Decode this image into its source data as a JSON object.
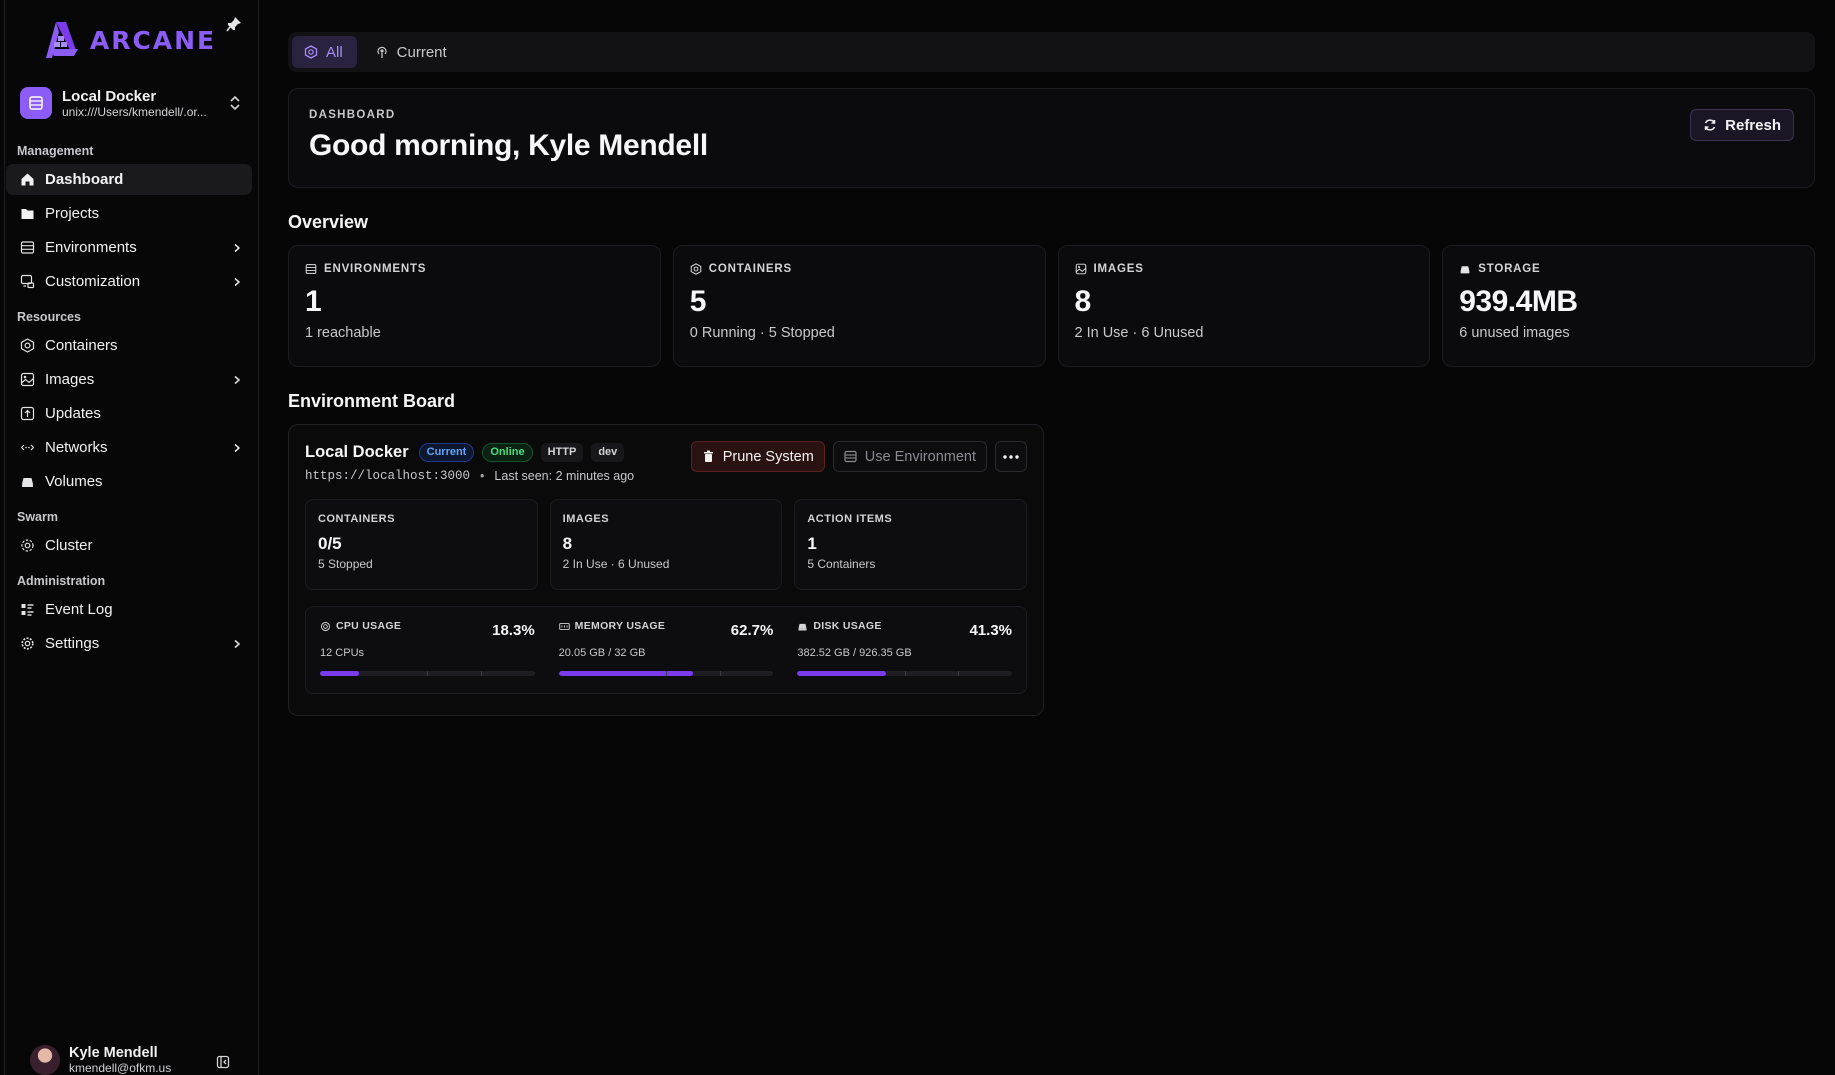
{
  "brand": {
    "name": "ARCANE",
    "accent": "#8b5cf6"
  },
  "env_switcher": {
    "name": "Local Docker",
    "socket": "unix:///Users/kmendell/.or..."
  },
  "sidebar": {
    "sections": [
      {
        "label": "Management",
        "items": [
          {
            "label": "Dashboard",
            "icon": "home-icon",
            "active": true,
            "chevron": false
          },
          {
            "label": "Projects",
            "icon": "folder-icon",
            "active": false,
            "chevron": false
          },
          {
            "label": "Environments",
            "icon": "server-icon",
            "active": false,
            "chevron": true
          },
          {
            "label": "Customization",
            "icon": "customize-icon",
            "active": false,
            "chevron": true
          }
        ]
      },
      {
        "label": "Resources",
        "items": [
          {
            "label": "Containers",
            "icon": "container-icon",
            "active": false,
            "chevron": false
          },
          {
            "label": "Images",
            "icon": "image-icon",
            "active": false,
            "chevron": true
          },
          {
            "label": "Updates",
            "icon": "update-icon",
            "active": false,
            "chevron": false
          },
          {
            "label": "Networks",
            "icon": "network-icon",
            "active": false,
            "chevron": true
          },
          {
            "label": "Volumes",
            "icon": "volume-icon",
            "active": false,
            "chevron": false
          }
        ]
      },
      {
        "label": "Swarm",
        "items": [
          {
            "label": "Cluster",
            "icon": "cluster-icon",
            "active": false,
            "chevron": false
          }
        ]
      },
      {
        "label": "Administration",
        "items": [
          {
            "label": "Event Log",
            "icon": "event-log-icon",
            "active": false,
            "chevron": false
          },
          {
            "label": "Settings",
            "icon": "gear-icon",
            "active": false,
            "chevron": true
          }
        ]
      }
    ]
  },
  "user": {
    "name": "Kyle Mendell",
    "email": "kmendell@ofkm.us"
  },
  "tabs": [
    {
      "label": "All",
      "active": true
    },
    {
      "label": "Current",
      "active": false
    }
  ],
  "hero": {
    "eyebrow": "DASHBOARD",
    "title": "Good morning, Kyle Mendell",
    "refresh_label": "Refresh"
  },
  "overview": {
    "title": "Overview",
    "cards": [
      {
        "label": "ENVIRONMENTS",
        "value": "1",
        "sub": "1 reachable",
        "icon": "server-icon"
      },
      {
        "label": "CONTAINERS",
        "value": "5",
        "sub": "0 Running · 5 Stopped",
        "icon": "container-icon"
      },
      {
        "label": "IMAGES",
        "value": "8",
        "sub": "2 In Use · 6 Unused",
        "icon": "image-icon"
      },
      {
        "label": "STORAGE",
        "value": "939.4MB",
        "sub": "6 unused images",
        "icon": "storage-icon"
      }
    ]
  },
  "board": {
    "title": "Environment Board",
    "env": {
      "name": "Local Docker",
      "badges": {
        "current": "Current",
        "online": "Online",
        "protocol": "HTTP",
        "tag": "dev"
      },
      "url": "https://localhost:3000",
      "separator": "•",
      "last_seen": "Last seen: 2 minutes ago",
      "prune_label": "Prune System",
      "use_label": "Use Environment",
      "mini": [
        {
          "label": "CONTAINERS",
          "value": "0/5",
          "sub": "5 Stopped"
        },
        {
          "label": "IMAGES",
          "value": "8",
          "sub": "2 In Use · 6 Unused"
        },
        {
          "label": "ACTION ITEMS",
          "value": "1",
          "sub": "5 Containers"
        }
      ],
      "usage": [
        {
          "label": "CPU USAGE",
          "pct": "18.3%",
          "fraction": 0.183,
          "sub": "12 CPUs",
          "icon": "cpu-icon"
        },
        {
          "label": "MEMORY USAGE",
          "pct": "62.7%",
          "fraction": 0.627,
          "sub": "20.05 GB / 32 GB",
          "icon": "memory-icon"
        },
        {
          "label": "DISK USAGE",
          "pct": "41.3%",
          "fraction": 0.413,
          "sub": "382.52 GB / 926.35 GB",
          "icon": "disk-icon"
        }
      ]
    }
  }
}
